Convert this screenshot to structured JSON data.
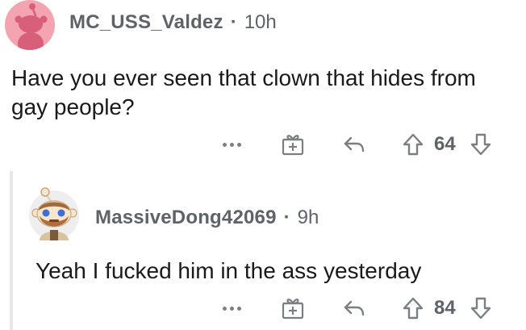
{
  "colors": {
    "meta_text": "#5f6266",
    "body_text": "#1a1a1b",
    "avatar1_bg": "#f4a3b0",
    "thread_line": "#e7e7e8"
  },
  "comments": [
    {
      "username": "MC_USS_Valdez",
      "separator": "·",
      "time": "10h",
      "body": "Have you ever seen that clown that hides from gay people?",
      "score": "64",
      "icons": [
        "more-options-icon",
        "award-icon",
        "reply-icon",
        "upvote-icon",
        "downvote-icon"
      ]
    },
    {
      "username": "MassiveDong42069",
      "separator": "·",
      "time": "9h",
      "body": "Yeah I fucked him in the ass yesterday",
      "score": "84",
      "icons": [
        "more-options-icon",
        "award-icon",
        "reply-icon",
        "upvote-icon",
        "downvote-icon"
      ]
    }
  ]
}
